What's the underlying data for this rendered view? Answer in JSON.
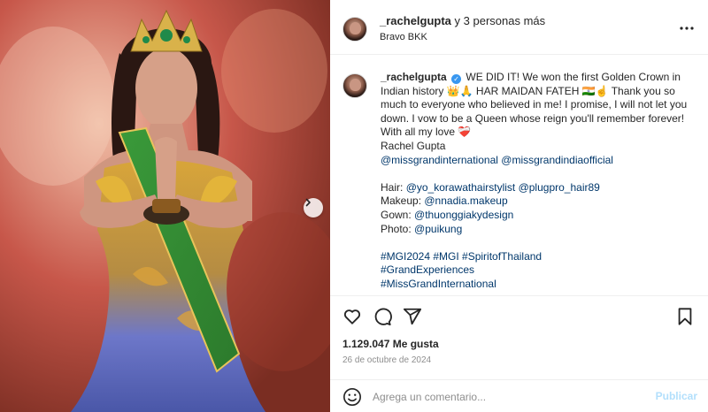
{
  "post": {
    "header": {
      "username": "_rachelgupta",
      "coauthors_suffix": "y 3 personas más",
      "location": "Bravo BKK",
      "more_icon": "more-horizontal-icon"
    },
    "caption": {
      "username": "_rachelgupta",
      "verified_icon": "verified-badge-icon",
      "text_1": "WE DID IT! We won the first Golden Crown in Indian history 👑🙏 HAR MAIDAN FATEH 🇮🇳☝️ Thank you so much to everyone who believed in me! I promise, I will not let you down. I vow to be a Queen whose reign you'll remember forever!",
      "line_love": "With all my love ❤️‍🩹",
      "signature": "Rachel Gupta",
      "mention_1": "@missgrandinternational",
      "mention_2": "@missgrandindiaofficial",
      "credits": [
        {
          "label": "Hair:",
          "handles": "@yo_korawathairstylist @plugpro_hair89"
        },
        {
          "label": "Makeup:",
          "handles": "@nnadia.makeup"
        },
        {
          "label": "Gown:",
          "handles": "@thuonggiakydesign"
        },
        {
          "label": "Photo:",
          "handles": "@puikung"
        }
      ],
      "hashtags_1": "#MGI2024 #MGI #SpiritofThailand",
      "hashtags_2": "#GrandExperiences",
      "hashtags_3": "#MissGrandInternational"
    },
    "actions": {
      "like_icon": "heart-icon",
      "comment_icon": "comment-icon",
      "share_icon": "share-icon",
      "save_icon": "bookmark-icon"
    },
    "likes": "1.129.047 Me gusta",
    "date": "26 de octubre de 2024",
    "comment": {
      "placeholder": "Agrega un comentario...",
      "publish_label": "Publicar",
      "emoji_icon": "emoji-icon"
    },
    "media": {
      "next_icon": "chevron-right-icon"
    }
  }
}
